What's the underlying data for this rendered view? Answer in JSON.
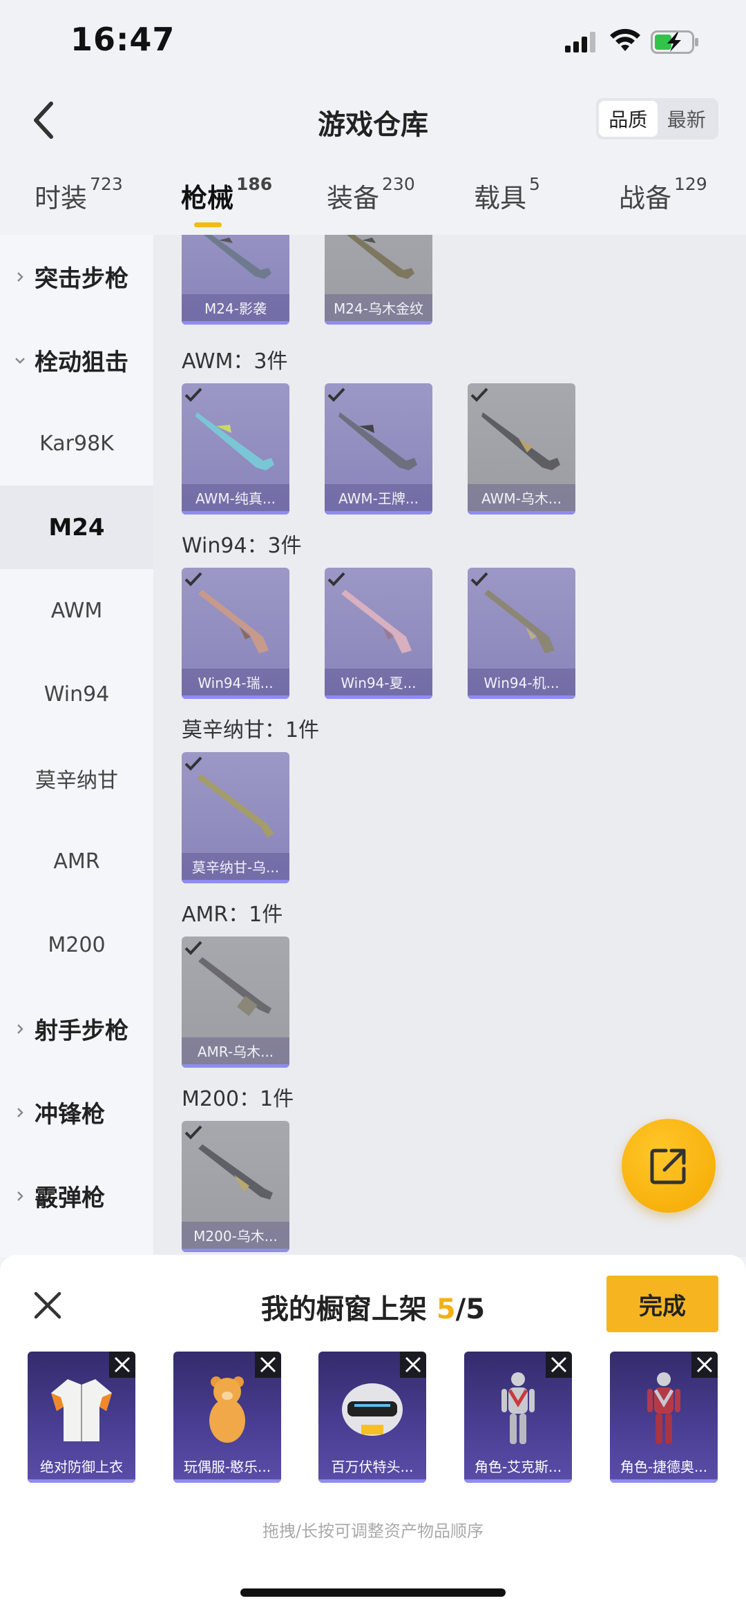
{
  "status_bar": {
    "time": "16:47"
  },
  "header": {
    "title": "游戏仓库",
    "sort_options": [
      "品质",
      "最新"
    ],
    "active_sort": "品质"
  },
  "tabs": [
    {
      "label": "时装",
      "count": "723"
    },
    {
      "label": "枪械",
      "count": "186"
    },
    {
      "label": "装备",
      "count": "230"
    },
    {
      "label": "载具",
      "count": "5"
    },
    {
      "label": "战备",
      "count": "129"
    }
  ],
  "active_tab": "枪械",
  "sidebar": {
    "items": [
      {
        "label": "突击步枪",
        "type": "group",
        "expanded": false
      },
      {
        "label": "栓动狙击",
        "type": "group",
        "expanded": true
      },
      {
        "label": "Kar98K",
        "type": "sub"
      },
      {
        "label": "M24",
        "type": "sub",
        "active": true
      },
      {
        "label": "AWM",
        "type": "sub"
      },
      {
        "label": "Win94",
        "type": "sub"
      },
      {
        "label": "莫辛纳甘",
        "type": "sub"
      },
      {
        "label": "AMR",
        "type": "sub"
      },
      {
        "label": "M200",
        "type": "sub"
      },
      {
        "label": "射手步枪",
        "type": "group",
        "expanded": false
      },
      {
        "label": "冲锋枪",
        "type": "group",
        "expanded": false
      },
      {
        "label": "霰弹枪",
        "type": "group",
        "expanded": false
      }
    ]
  },
  "sections": [
    {
      "label": "",
      "items": [
        {
          "name": "M24-影袭",
          "style": "purple",
          "checked": false
        },
        {
          "name": "M24-乌木金纹",
          "style": "gray",
          "checked": false
        }
      ]
    },
    {
      "label": "AWM：3件",
      "items": [
        {
          "name": "AWM-纯真...",
          "style": "purple",
          "checked": true
        },
        {
          "name": "AWM-王牌...",
          "style": "purple",
          "checked": true
        },
        {
          "name": "AWM-乌木...",
          "style": "gray",
          "checked": true
        }
      ]
    },
    {
      "label": "Win94：3件",
      "items": [
        {
          "name": "Win94-瑞...",
          "style": "purple",
          "checked": true
        },
        {
          "name": "Win94-夏...",
          "style": "purple",
          "checked": true
        },
        {
          "name": "Win94-机...",
          "style": "purple",
          "checked": true
        }
      ]
    },
    {
      "label": "莫辛纳甘：1件",
      "items": [
        {
          "name": "莫辛纳甘-乌...",
          "style": "purple",
          "checked": true
        }
      ]
    },
    {
      "label": "AMR：1件",
      "items": [
        {
          "name": "AMR-乌木...",
          "style": "gray",
          "checked": true
        }
      ]
    },
    {
      "label": "M200：1件",
      "items": [
        {
          "name": "M200-乌木...",
          "style": "gray",
          "checked": true
        }
      ]
    }
  ],
  "sheet": {
    "title_prefix": "我的橱窗上架 ",
    "count_current": "5",
    "count_sep_total": "/5",
    "done_label": "完成",
    "items": [
      {
        "name": "绝对防御上衣",
        "icon": "jacket-icon"
      },
      {
        "name": "玩偶服-憨乐...",
        "icon": "bear-costume-icon"
      },
      {
        "name": "百万伏特头...",
        "icon": "helmet-icon"
      },
      {
        "name": "角色-艾克斯...",
        "icon": "hero-figure-icon"
      },
      {
        "name": "角色-捷德奥...",
        "icon": "hero-figure-icon"
      }
    ],
    "hint": "拖拽/长按可调整资产物品顺序"
  },
  "colors": {
    "accent": "#f6b520",
    "card_purple": "#8e8abd",
    "card_gray": "#9fa0a6"
  }
}
